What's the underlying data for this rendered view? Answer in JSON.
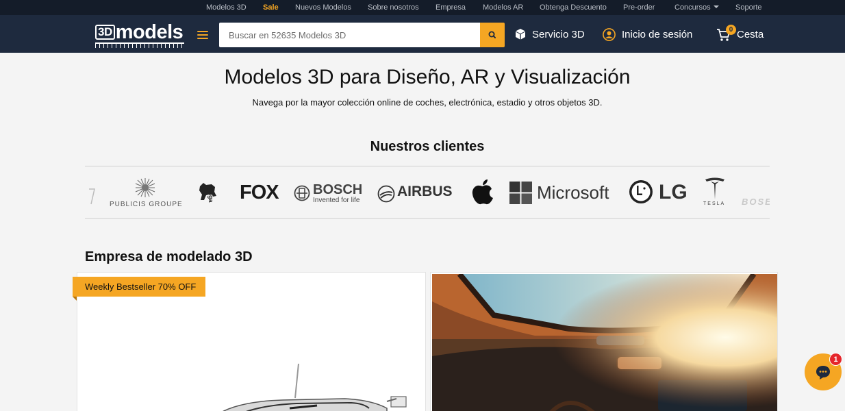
{
  "topnav": {
    "items": [
      "Modelos 3D",
      "Sale",
      "Nuevos Modelos",
      "Sobre nosotros",
      "Empresa",
      "Modelos AR",
      "Obtenga Descuento",
      "Pre-order",
      "Concursos",
      "Soporte"
    ]
  },
  "header": {
    "logo_prefix": "3D",
    "logo_text": "models",
    "search_placeholder": "Buscar en 52635 Modelos 3D",
    "service_label": "Servicio 3D",
    "login_label": "Inicio de sesión",
    "cart_label": "Cesta",
    "cart_count": "0"
  },
  "hero": {
    "title": "Modelos 3D para Diseño, AR y Visualización",
    "subtitle": "Navega por la mayor colección online de coches, electrónica, estadio y otros objetos 3D."
  },
  "clients": {
    "title": "Nuestros clientes",
    "publicis": "PUBLICIS GROUPE",
    "zynga": "zynga",
    "fox": "FOX",
    "bosch": "BOSCH",
    "bosch_tagline": "Invented for life",
    "airbus": "AIRBUS",
    "microsoft": "Microsoft",
    "lg": "LG",
    "tesla": "TESLA",
    "bose": "BOSE"
  },
  "section": {
    "title": "Empresa de modelado 3D",
    "ribbon": "Weekly Bestseller 70% OFF"
  },
  "chat": {
    "unread": "1"
  },
  "colors": {
    "accent": "#f5a623",
    "header_bg": "#1e2a3e",
    "topbar_bg": "#141c29"
  }
}
